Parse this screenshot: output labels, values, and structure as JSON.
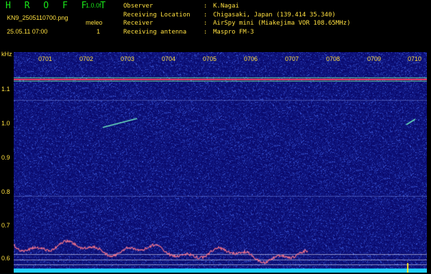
{
  "header": {
    "app_title": "H R O F F T",
    "version": "1.0.0f",
    "filename": "KN9_2505110700.png",
    "meleo_label": "meleo",
    "datetime": "25.05.11 07:00",
    "count": "1",
    "info": [
      {
        "key": "Observer",
        "value": "K.Nagai"
      },
      {
        "key": "Receiving Location",
        "value": "Chigasaki, Japan (139.414 35.340)"
      },
      {
        "key": "Receiver",
        "value": "AirSpy mini (Miakejima VOR 108.65MHz)"
      },
      {
        "key": "Receiving antenna",
        "value": "Maspro FM-3"
      }
    ]
  },
  "spectrogram": {
    "y_unit": "kHz",
    "y_ticks": [
      "1.1",
      "1.0",
      "0.9",
      "0.8",
      "0.7",
      "0.6"
    ],
    "x_ticks": [
      "0701",
      "0702",
      "0703",
      "0704",
      "0705",
      "0706",
      "0707",
      "0708",
      "0709",
      "0710"
    ],
    "background_color": "#0a0a6e",
    "carrier_color": "#ff4060"
  }
}
